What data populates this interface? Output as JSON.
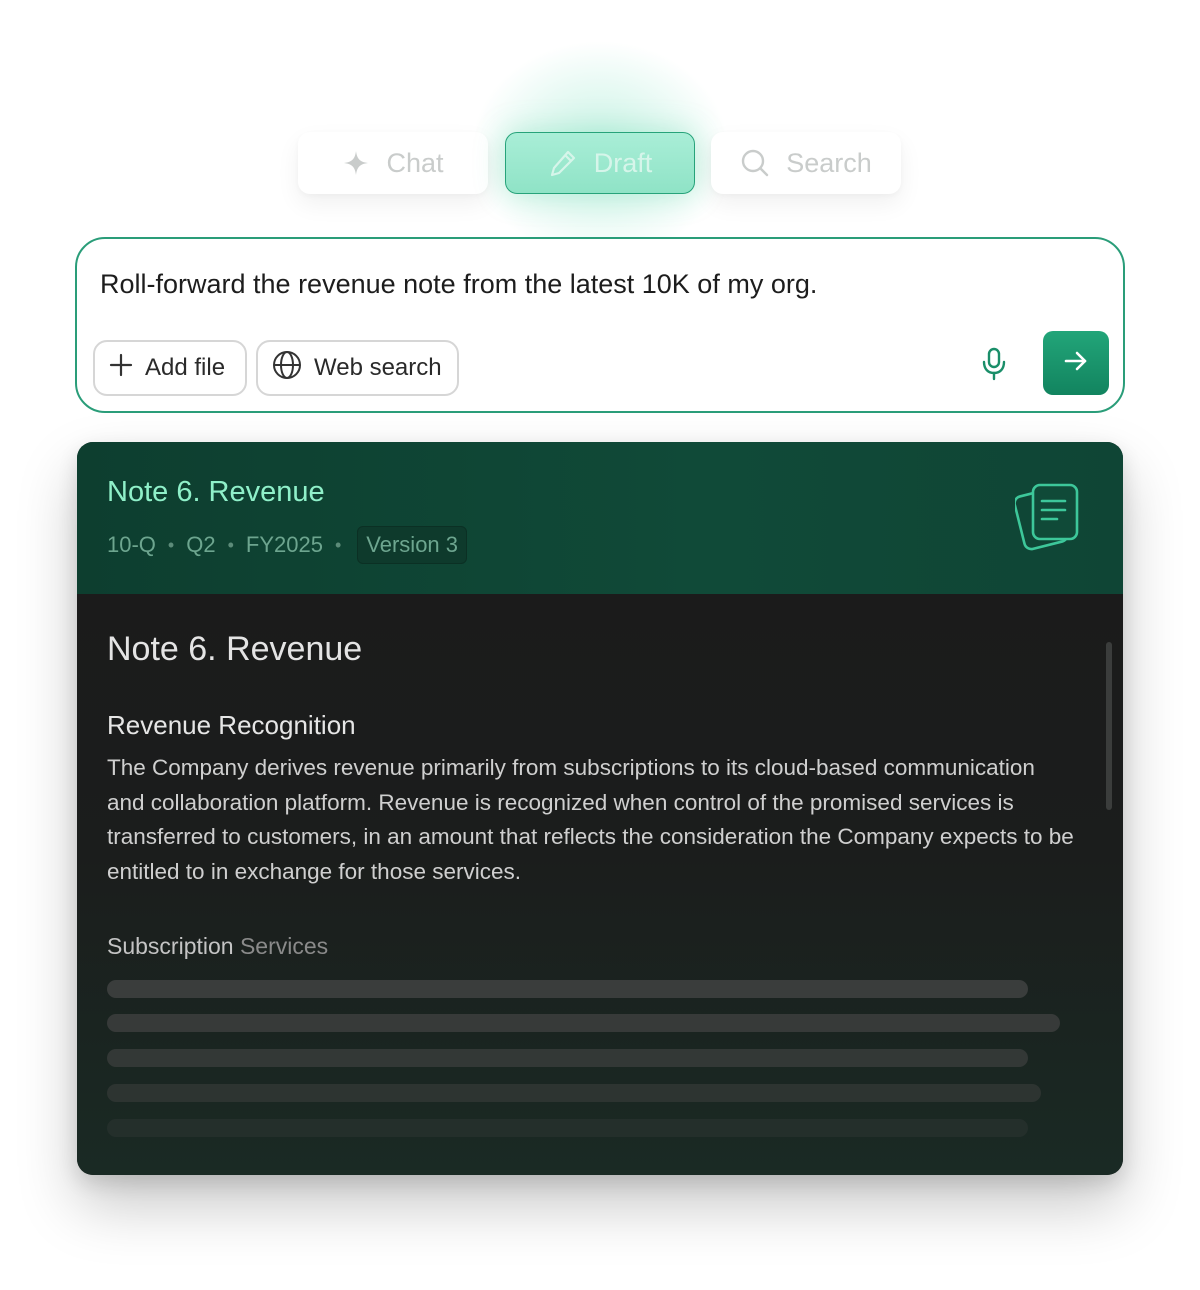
{
  "modes": {
    "chat": {
      "label": "Chat",
      "icon": "sparkle-icon"
    },
    "draft": {
      "label": "Draft",
      "icon": "pencil-icon",
      "active": true
    },
    "search": {
      "label": "Search",
      "icon": "search-icon"
    }
  },
  "prompt": {
    "text": "Roll-forward the revenue note from the latest 10K of my org.",
    "add_file_label": "Add file",
    "web_search_label": "Web search"
  },
  "document": {
    "header_title": "Note 6. Revenue",
    "meta": [
      "10-Q",
      "Q2",
      "FY2025"
    ],
    "version": "Version 3",
    "title": "Note 6. Revenue",
    "section_title": "Revenue Recognition",
    "paragraph": "The Company derives revenue primarily from subscriptions to its cloud-based communication and collaboration platform. Revenue is recognized when control of the promised services is transferred to customers, in an amount that reflects the consideration the Company expects to be entitled to in exchange for those services.",
    "subsection_prefix": "Subscription",
    "subsection_suffix": " Services"
  },
  "colors": {
    "accent": "#1a9a72",
    "header_bg": "#0f4535",
    "body_bg": "#1b1c1b"
  }
}
